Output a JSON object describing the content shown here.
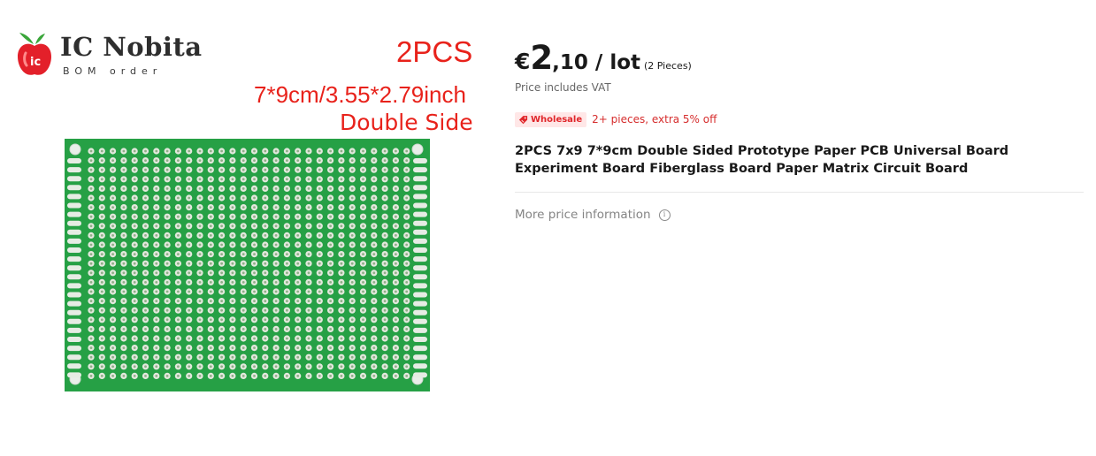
{
  "image": {
    "logo_name": "IC Nobita",
    "logo_tagline": "BOM order",
    "promo_quantity": "2PCS",
    "promo_size": "7*9cm/3.55*2.79inch",
    "promo_side": "Double Side",
    "board_color": "#26a045",
    "promo_color": "#e8221b"
  },
  "price": {
    "currency": "€",
    "integer": "2",
    "rest": ",10 / lot",
    "unit": "(2 Pieces)",
    "vat_note": "Price includes VAT"
  },
  "wholesale": {
    "badge_icon": "tag-icon",
    "badge_label": "Wholesale",
    "text": "2+ pieces, extra 5% off",
    "accent": "#e0262a"
  },
  "product": {
    "title": "2PCS 7x9 7*9cm Double Sided Prototype Paper PCB Universal Board Experiment Board Fiberglass Board Paper Matrix Circuit Board"
  },
  "more_info": {
    "label": "More price information",
    "icon": "info-icon"
  }
}
